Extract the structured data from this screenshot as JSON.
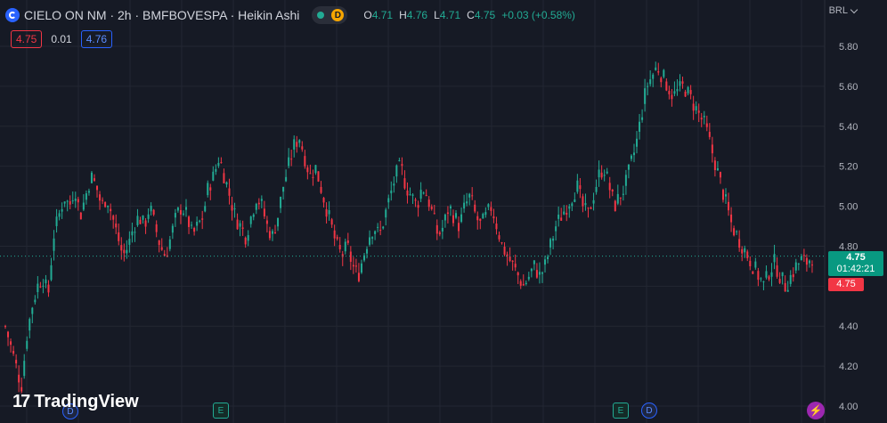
{
  "header": {
    "title": "CIELO ON NM · 2h · BMFBOVESPA · Heikin Ashi",
    "delay_badge": "D",
    "ohlc": {
      "o_label": "O",
      "o_value": "4.71",
      "h_label": "H",
      "h_value": "4.76",
      "l_label": "L",
      "l_value": "4.71",
      "c_label": "C",
      "c_value": "4.75",
      "change": "+0.03 (+0.58%)"
    }
  },
  "trade": {
    "bid": "4.75",
    "spread": "0.01",
    "ask": "4.76"
  },
  "currency": "BRL",
  "last_price": {
    "value": "4.75",
    "countdown": "01:42:21",
    "red_value": "4.75"
  },
  "events": [
    "D",
    "E",
    "E",
    "D"
  ],
  "brand": "TradingView",
  "colors": {
    "up": "#22ab94",
    "down": "#f23645",
    "background": "#161a25",
    "grid": "#232732",
    "axis_text": "#b2b5be",
    "price_line": "#22ab94"
  },
  "chart_data": {
    "type": "candlestick",
    "style": "Heikin Ashi",
    "ylim": [
      4.0,
      5.82
    ],
    "yticks": [
      "5.80",
      "5.60",
      "5.40",
      "5.20",
      "5.00",
      "4.80",
      "4.60",
      "4.40",
      "4.20",
      "4.00"
    ],
    "last_price": 4.75,
    "grid": true,
    "close_path": [
      4.4,
      4.3,
      4.2,
      4.1,
      4.35,
      4.5,
      4.6,
      4.65,
      4.55,
      4.85,
      4.95,
      5.05,
      5.0,
      5.1,
      4.95,
      5.05,
      5.15,
      5.1,
      5.0,
      5.05,
      4.95,
      4.85,
      4.75,
      4.8,
      4.9,
      4.95,
      4.9,
      5.0,
      4.9,
      4.8,
      4.75,
      4.85,
      4.95,
      5.0,
      4.95,
      4.85,
      4.9,
      4.95,
      5.1,
      5.15,
      5.25,
      5.15,
      5.05,
      4.95,
      4.9,
      4.85,
      4.95,
      5.05,
      5.0,
      4.9,
      4.85,
      4.95,
      5.1,
      5.2,
      5.3,
      5.35,
      5.25,
      5.15,
      5.2,
      5.1,
      5.0,
      4.9,
      4.8,
      4.75,
      4.8,
      4.7,
      4.65,
      4.75,
      4.85,
      4.9,
      4.85,
      4.95,
      5.05,
      5.15,
      5.2,
      5.1,
      5.05,
      5.0,
      5.1,
      5.05,
      4.95,
      4.85,
      4.9,
      5.0,
      4.95,
      4.9,
      5.0,
      5.05,
      4.95,
      4.9,
      4.95,
      5.0,
      4.9,
      4.8,
      4.75,
      4.7,
      4.65,
      4.6,
      4.65,
      4.7,
      4.65,
      4.7,
      4.8,
      4.9,
      4.95,
      5.0,
      5.05,
      5.1,
      5.0,
      4.95,
      5.05,
      5.15,
      5.2,
      5.1,
      5.0,
      5.05,
      5.1,
      5.2,
      5.3,
      5.45,
      5.6,
      5.65,
      5.7,
      5.65,
      5.6,
      5.55,
      5.58,
      5.6,
      5.55,
      5.5,
      5.45,
      5.4,
      5.3,
      5.2,
      5.1,
      5.0,
      4.9,
      4.85,
      4.8,
      4.75,
      4.7,
      4.65,
      4.6,
      4.68,
      4.72,
      4.65,
      4.6,
      4.65,
      4.7,
      4.73,
      4.72,
      4.75
    ]
  }
}
